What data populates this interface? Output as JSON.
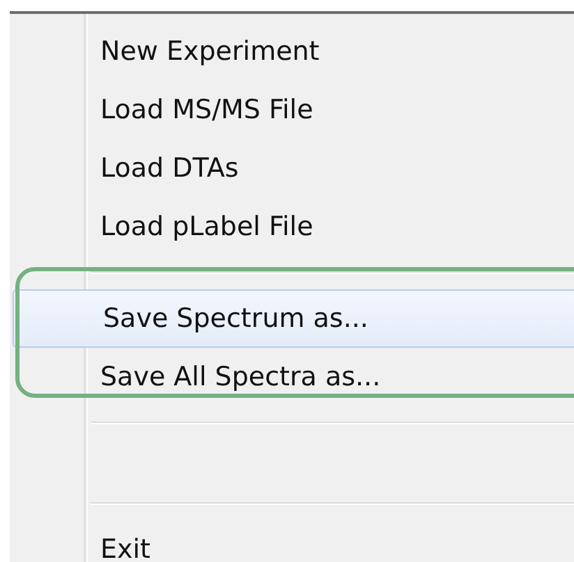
{
  "menu": {
    "items": [
      {
        "kind": "item",
        "label": "New Experiment",
        "selected": false
      },
      {
        "kind": "item",
        "label": "Load MS/MS File",
        "selected": false
      },
      {
        "kind": "item",
        "label": "Load DTAs",
        "selected": false
      },
      {
        "kind": "item",
        "label": "Load pLabel File",
        "selected": false
      },
      {
        "kind": "separator"
      },
      {
        "kind": "item",
        "label": "Save Spectrum as...",
        "selected": true
      },
      {
        "kind": "item",
        "label": "Save All Spectra as...",
        "selected": false
      },
      {
        "kind": "separator"
      },
      {
        "kind": "blank"
      },
      {
        "kind": "separator"
      },
      {
        "kind": "item",
        "label": "Exit",
        "selected": false
      }
    ]
  }
}
